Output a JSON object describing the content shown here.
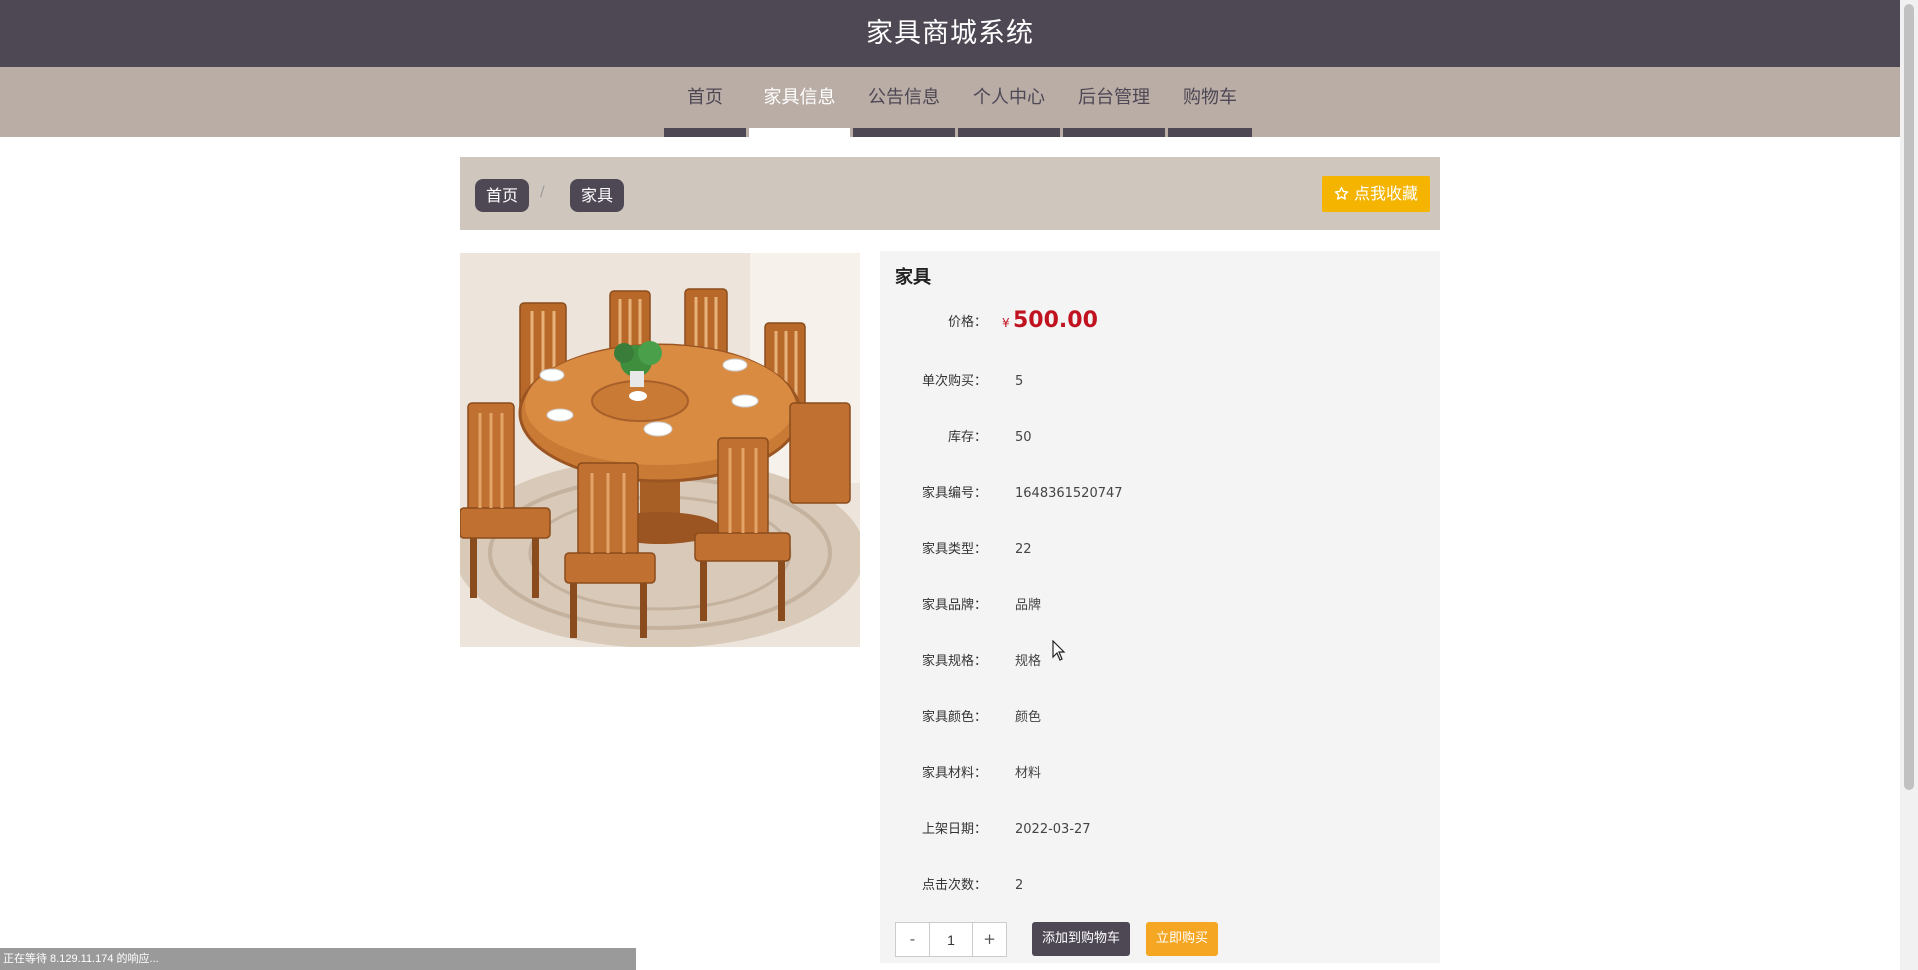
{
  "header": {
    "title": "家具商城系统"
  },
  "nav": {
    "items": [
      {
        "label": "首页",
        "active": false
      },
      {
        "label": "家具信息",
        "active": true
      },
      {
        "label": "公告信息",
        "active": false
      },
      {
        "label": "个人中心",
        "active": false
      },
      {
        "label": "后台管理",
        "active": false
      },
      {
        "label": "购物车",
        "active": false
      }
    ]
  },
  "breadcrumb": {
    "home": "首页",
    "separator": "/",
    "current": "家具"
  },
  "favorite_button": {
    "icon": "star-outline-icon",
    "label": "点我收藏"
  },
  "product": {
    "image_alt": "round wooden dining table with chairs",
    "title": "家具",
    "price_label": "价格：",
    "currency_symbol": "¥",
    "price": "500.00",
    "attributes": [
      {
        "label": "单次购买：",
        "value": "5"
      },
      {
        "label": "库存：",
        "value": "50"
      },
      {
        "label": "家具编号：",
        "value": "1648361520747"
      },
      {
        "label": "家具类型：",
        "value": "22"
      },
      {
        "label": "家具品牌：",
        "value": "品牌"
      },
      {
        "label": "家具规格：",
        "value": "规格"
      },
      {
        "label": "家具颜色：",
        "value": "颜色"
      },
      {
        "label": "家具材料：",
        "value": "材料"
      },
      {
        "label": "上架日期：",
        "value": "2022-03-27"
      },
      {
        "label": "点击次数：",
        "value": "2"
      }
    ]
  },
  "quantity": {
    "minus": "-",
    "value": "1",
    "plus": "+"
  },
  "actions": {
    "add_to_cart": "添加到购物车",
    "buy_now": "立即购买"
  },
  "status_bar": {
    "text": "正在等待 8.129.11.174 的响应..."
  },
  "colors": {
    "header_bg": "#4e4855",
    "nav_bg": "#b9ada6",
    "breadcrumb_bg": "#cfc7be",
    "accent_yellow": "#f4b400",
    "price_red": "#c1121f",
    "buy_orange": "#f5a623"
  }
}
